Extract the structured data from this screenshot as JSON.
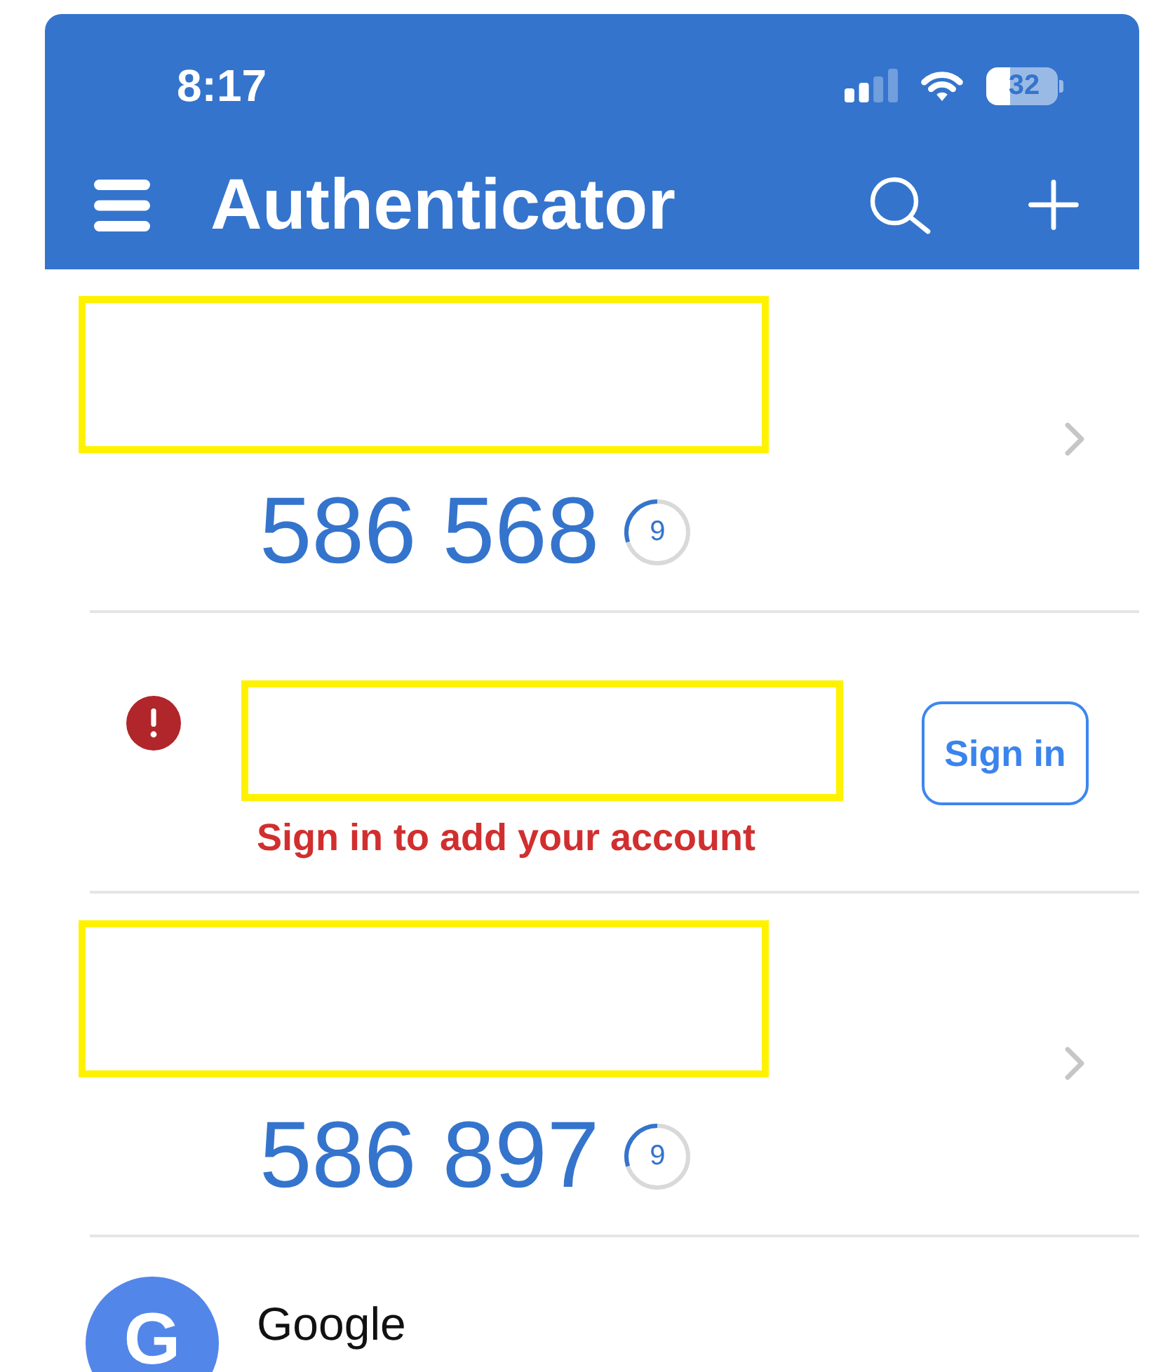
{
  "status_bar": {
    "time": "8:17",
    "battery": "32"
  },
  "app_bar": {
    "title": "Authenticator"
  },
  "accounts": [
    {
      "kind": "code",
      "redacted": true,
      "code": "586 568",
      "countdown": "9",
      "level": 0.3
    },
    {
      "kind": "sign_in",
      "redacted": true,
      "message": "Sign in to add your account",
      "button": "Sign in"
    },
    {
      "kind": "code",
      "redacted": true,
      "code": "586 897",
      "countdown": "9",
      "level": 0.3
    },
    {
      "kind": "account",
      "avatar": "G",
      "name": "Google"
    }
  ]
}
